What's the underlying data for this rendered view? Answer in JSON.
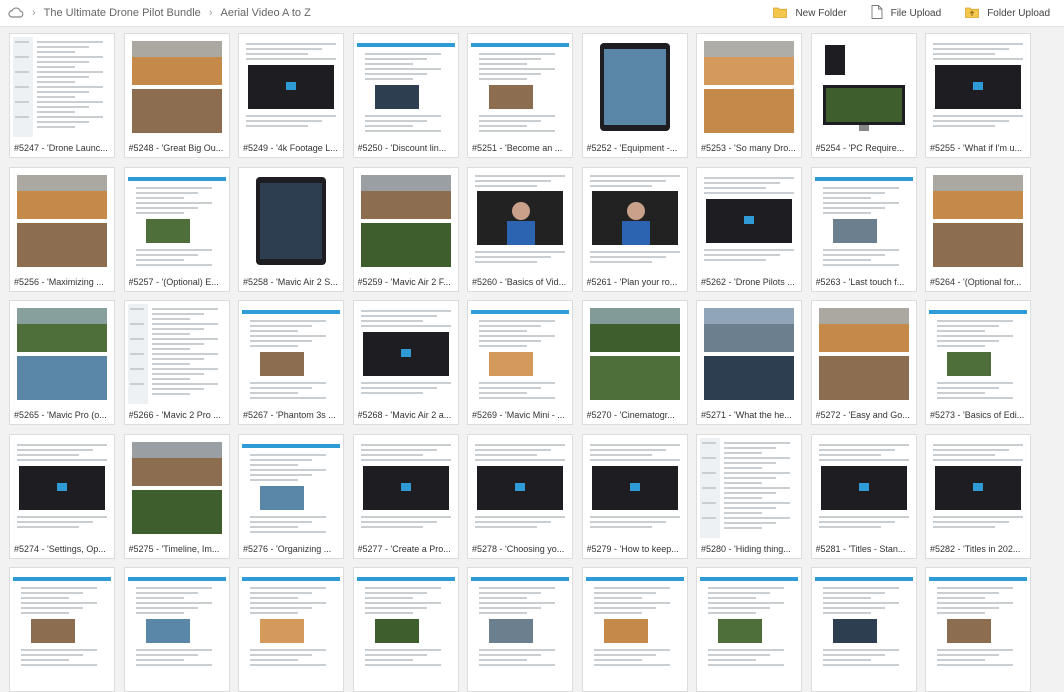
{
  "breadcrumb": [
    "The Ultimate Drone Pilot Bundle",
    "Aerial Video A to Z"
  ],
  "actions": [
    {
      "label": "New Folder",
      "icon": "folder-icon"
    },
    {
      "label": "File Upload",
      "icon": "file-icon"
    },
    {
      "label": "Folder Upload",
      "icon": "folder-upload-icon"
    }
  ],
  "files": [
    "#5247 - 'Drone Launc...",
    "#5248 - 'Great Big Ou...",
    "#5249 - '4k Footage L...",
    "#5250 - 'Discount lin...",
    "#5251 - 'Become an ...",
    "#5252 - 'Equipment -...",
    "#5253 - 'So many Dro...",
    "#5254 - 'PC Require...",
    "#5255 - 'What if I'm u...",
    "#5256 - 'Maximizing ...",
    "#5257 - '(Optional) E...",
    "#5258 - 'Mavic Air 2 S...",
    "#5259 - 'Mavic Air 2 F...",
    "#5260 - 'Basics of Vid...",
    "#5261 - 'Plan your ro...",
    "#5262 - 'Drone Pilots ...",
    "#5263 - 'Last touch f...",
    "#5264 - '(Optional for...",
    "#5265 - 'Mavic Pro (o...",
    "#5266 - 'Mavic 2 Pro ...",
    "#5267 - 'Phantom 3s ...",
    "#5268 - 'Mavic Air 2 a...",
    "#5269 - 'Mavic Mini - ...",
    "#5270 - 'Cinematogr...",
    "#5271 - 'What the he...",
    "#5272 - 'Easy and Go...",
    "#5273 - 'Basics of Edi...",
    "#5274 - 'Settings, Op...",
    "#5275 - 'Timeline, Im...",
    "#5276 - 'Organizing ...",
    "#5277 - 'Create a Pro...",
    "#5278 - 'Choosing yo...",
    "#5279 - 'How to keep...",
    "#5280 - 'Hiding thing...",
    "#5281 - 'Titles - Stan...",
    "#5282 - 'Titles in 202...",
    "",
    "",
    "",
    "",
    "",
    "",
    "",
    "",
    ""
  ],
  "thumb_types": [
    "list",
    "photo",
    "video",
    "doc",
    "doc",
    "phone",
    "photo",
    "monitor",
    "video",
    "photo",
    "doc",
    "phone",
    "photo",
    "person",
    "person",
    "video",
    "doc",
    "photo",
    "photo",
    "list",
    "doc",
    "video",
    "doc",
    "photo",
    "photo",
    "photo",
    "doc",
    "video",
    "photo",
    "doc",
    "video",
    "video",
    "video",
    "list",
    "video",
    "video",
    "doc",
    "doc",
    "doc",
    "doc",
    "doc",
    "doc",
    "doc",
    "doc",
    "doc"
  ],
  "colors": {
    "accent": "#2e9bd6",
    "folder": "#f3c64d",
    "dark": "#1e1e22"
  }
}
